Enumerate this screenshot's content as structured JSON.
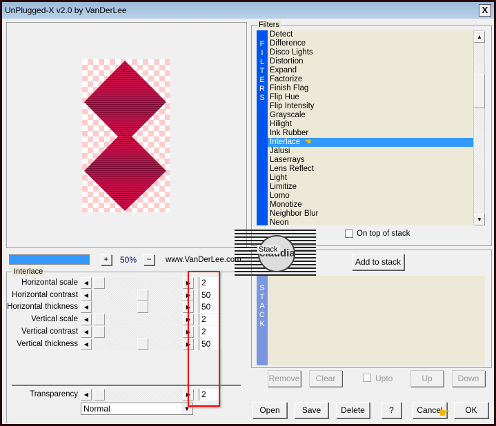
{
  "window": {
    "title": "UnPlugged-X v2.0 by VanDerLee",
    "close_label": "X"
  },
  "preview": {
    "zoom": "50%",
    "plus": "+",
    "minus": "−",
    "website": "www.VanDerLee.com",
    "progress_percent": 100
  },
  "settings": {
    "group_label": "Interlace",
    "rows": [
      {
        "label": "Horizontal scale",
        "value": "2",
        "fraction": 0.02
      },
      {
        "label": "Horizontal contrast",
        "value": "50",
        "fraction": 0.5
      },
      {
        "label": "Horizontal thickness",
        "value": "50",
        "fraction": 0.5
      },
      {
        "label": "Vertical scale",
        "value": "2",
        "fraction": 0.02
      },
      {
        "label": "Vertical contrast",
        "value": "2",
        "fraction": 0.02
      },
      {
        "label": "Vertical thickness",
        "value": "50",
        "fraction": 0.5
      }
    ],
    "transparency": {
      "label": "Transparency",
      "value": "2",
      "fraction": 0.02
    },
    "blend_mode": "Normal"
  },
  "filters": {
    "group_label": "Filters",
    "strip": "FILTERS",
    "items": [
      "Detect",
      "Difference",
      "Disco Lights",
      "Distortion",
      "Expand",
      "Factorize",
      "Finish Flag",
      "Flip Hue",
      "Flip Intensity",
      "Grayscale",
      "Hilight",
      "Ink Rubber",
      "Interlace",
      "Jalusi",
      "Laserrays",
      "Lens Reflect",
      "Light",
      "Limitize",
      "Lomo",
      "Monotize",
      "Neighbor Blur",
      "Neon"
    ],
    "selected": "Interlace",
    "on_top_label": "On top of stack"
  },
  "stack": {
    "group_label": "Stack",
    "strip": "STACK",
    "add_label": "Add to stack",
    "remove": "Remove",
    "clear": "Clear",
    "upto": "Upto",
    "up": "Up",
    "down": "Down"
  },
  "buttons": {
    "open": "Open",
    "save": "Save",
    "delete": "Delete",
    "help": "?",
    "cancel": "Cancel",
    "ok": "OK"
  },
  "watermark": "claudia",
  "colors": {
    "selection": "#3399ff",
    "strip": "#0055ee",
    "highlight": "#ff0000"
  }
}
